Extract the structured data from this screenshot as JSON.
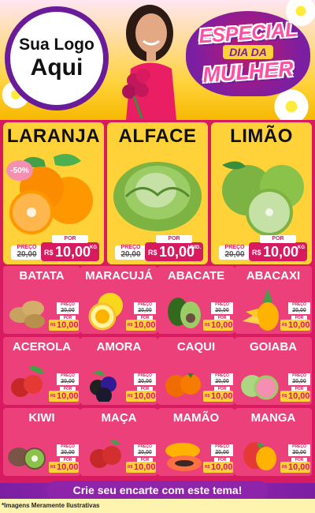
{
  "header": {
    "logo_line1": "Sua Logo",
    "logo_line2": "Aqui",
    "badge_line1": "ESPECIAL",
    "badge_line2": "DIA DA",
    "badge_line3": "MULHER"
  },
  "featured": [
    {
      "name": "LARANJA",
      "discount": "-50%",
      "old_label": "PREÇO",
      "old_price": "20,00",
      "new_label": "POR",
      "currency": "R$",
      "price": "10,00",
      "unit": "KG"
    },
    {
      "name": "ALFACE",
      "old_label": "PREÇO",
      "old_price": "20,00",
      "new_label": "POR",
      "currency": "R$",
      "price": "10,00",
      "unit": "UNID."
    },
    {
      "name": "LIMÃO",
      "old_label": "PREÇO",
      "old_price": "20,00",
      "new_label": "POR",
      "currency": "R$",
      "price": "10,00",
      "unit": "KG"
    }
  ],
  "products": [
    {
      "name": "BATATA",
      "old_label": "PREÇO",
      "old_price": "20,00",
      "new_label": "POR",
      "currency": "R$",
      "price": "10,00"
    },
    {
      "name": "MARACUJÁ",
      "old_label": "PREÇO",
      "old_price": "20,00",
      "new_label": "POR",
      "currency": "R$",
      "price": "10,00"
    },
    {
      "name": "ABACATE",
      "old_label": "PREÇO",
      "old_price": "20,00",
      "new_label": "POR",
      "currency": "R$",
      "price": "10,00"
    },
    {
      "name": "ABACAXI",
      "old_label": "PREÇO",
      "old_price": "20,00",
      "new_label": "POR",
      "currency": "R$",
      "price": "10,00"
    },
    {
      "name": "ACEROLA",
      "old_label": "PREÇO",
      "old_price": "20,00",
      "new_label": "POR",
      "currency": "R$",
      "price": "10,00"
    },
    {
      "name": "AMORA",
      "old_label": "PREÇO",
      "old_price": "20,00",
      "new_label": "POR",
      "currency": "R$",
      "price": "10,00"
    },
    {
      "name": "CAQUI",
      "old_label": "PREÇO",
      "old_price": "20,00",
      "new_label": "POR",
      "currency": "R$",
      "price": "10,00"
    },
    {
      "name": "GOIABA",
      "old_label": "PREÇO",
      "old_price": "20,00",
      "new_label": "POR",
      "currency": "R$",
      "price": "10,00"
    },
    {
      "name": "KIWI",
      "old_label": "PREÇO",
      "old_price": "20,00",
      "new_label": "POR",
      "currency": "R$",
      "price": "10,00"
    },
    {
      "name": "MAÇA",
      "old_label": "PREÇO",
      "old_price": "20,00",
      "new_label": "POR",
      "currency": "R$",
      "price": "10,00"
    },
    {
      "name": "MAMÃO",
      "old_label": "PREÇO",
      "old_price": "20,00",
      "new_label": "POR",
      "currency": "R$",
      "price": "10,00"
    },
    {
      "name": "MANGA",
      "old_label": "PREÇO",
      "old_price": "20,00",
      "new_label": "POR",
      "currency": "R$",
      "price": "10,00"
    }
  ],
  "footer": {
    "cta": "Crie seu encarte com este tema!",
    "note": "*Imagens Meramente Ilustrativas"
  },
  "colors": {
    "pink": "#d81b60",
    "yellow": "#ffd23a",
    "purple": "#7b1fa2"
  }
}
